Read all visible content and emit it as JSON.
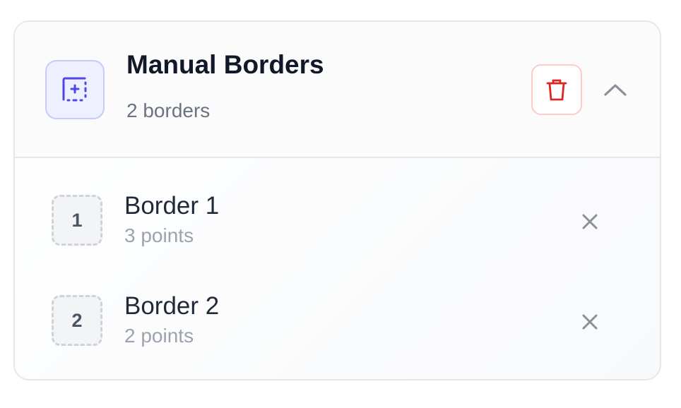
{
  "header": {
    "title": "Manual Borders",
    "subtitle": "2 borders",
    "icon": "dashed-square-plus-icon",
    "actions": {
      "delete_icon": "trash-icon",
      "collapse_icon": "chevron-up-icon"
    }
  },
  "borders": [
    {
      "index": "1",
      "name": "Border 1",
      "points": "3 points"
    },
    {
      "index": "2",
      "name": "Border 2",
      "points": "2 points"
    }
  ],
  "colors": {
    "accent": "#6366f1",
    "accent_bg": "#eef0ff",
    "danger": "#dc2626",
    "danger_border": "#fecaca",
    "muted": "#9ca3af"
  }
}
